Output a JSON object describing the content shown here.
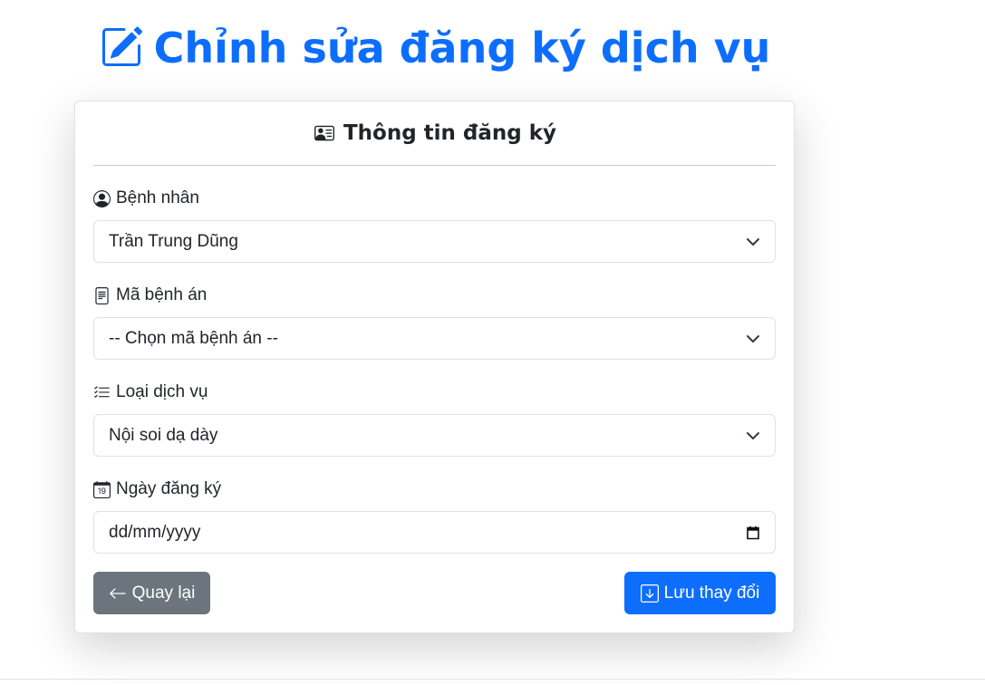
{
  "page": {
    "title": "Chỉnh sửa đăng ký dịch vụ",
    "title_icon": "pencil-square-icon",
    "accent_color": "#0d6efd"
  },
  "card": {
    "header": "Thông tin đăng ký",
    "header_icon": "person-vcard-icon"
  },
  "form": {
    "patient": {
      "label": "Bệnh nhân",
      "icon": "person-circle-icon",
      "value": "Trần Trung Dũng"
    },
    "record": {
      "label": "Mã bệnh án",
      "icon": "file-text-icon",
      "value": "-- Chọn mã bệnh án --"
    },
    "service": {
      "label": "Loại dịch vụ",
      "icon": "list-check-icon",
      "value": "Nội soi dạ dày"
    },
    "date": {
      "label": "Ngày đăng ký",
      "icon": "calendar-date-icon",
      "placeholder": "dd/mm/yyyy"
    }
  },
  "actions": {
    "back_label": "Quay lại",
    "back_color": "#6c757d",
    "save_label": "Lưu thay đổi",
    "save_color": "#0d6efd"
  }
}
